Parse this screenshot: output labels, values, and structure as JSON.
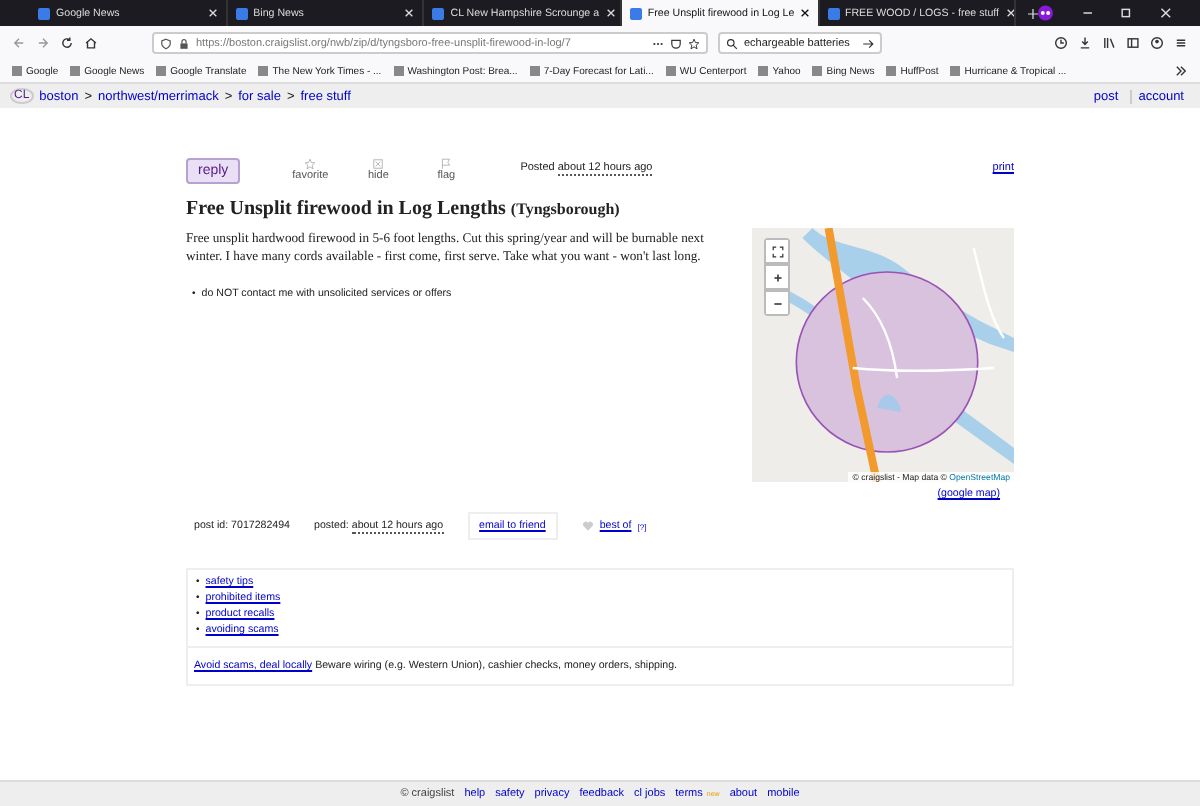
{
  "browser": {
    "tabs": [
      {
        "title": "Google News",
        "selected": false
      },
      {
        "title": "Bing News",
        "selected": false
      },
      {
        "title": "CL New Hampshire Scrounge a",
        "selected": false
      },
      {
        "title": "Free Unsplit firewood in Log Le",
        "selected": true
      },
      {
        "title": "FREE WOOD / LOGS - free stuff",
        "selected": false
      }
    ],
    "url": "https://boston.craigslist.org/nwb/zip/d/tyngsboro-free-unsplit-firewood-in-log/7",
    "search": "echargeable batteries",
    "bookmarks": [
      "Google",
      "Google News",
      "Google Translate",
      "The New York Times - ...",
      "Washington Post: Brea...",
      "7-Day Forecast for Lati...",
      "WU Centerport",
      "Yahoo",
      "Bing News",
      "HuffPost",
      "Hurricane & Tropical ..."
    ]
  },
  "header": {
    "logo": "CL",
    "breadcrumbs": [
      "boston",
      "northwest/merrimack",
      "for sale",
      "free stuff"
    ],
    "separator": ">",
    "links": [
      "post",
      "account"
    ]
  },
  "actions": {
    "reply": "reply",
    "tools": [
      {
        "label": "favorite",
        "kind": "star"
      },
      {
        "label": "hide",
        "kind": "hide"
      },
      {
        "label": "flag",
        "kind": "flag"
      }
    ],
    "posted_label": "Posted",
    "posted_time": "about 12 hours ago",
    "print": "print"
  },
  "title": "Free Unsplit firewood in Log Lengths",
  "location": "(Tyngsborough)",
  "body": "Free unsplit hardwood firewood in 5-6 foot lengths. Cut this spring/year and will be burnable next winter. I have many cords available - first come, first serve. Take what you want - won't last long.",
  "bullet": "•",
  "notices": [
    "do NOT contact me with unsolicited services or offers"
  ],
  "map": {
    "attribution_prefix": "© craigslist - Map data ©",
    "attribution_link": "OpenStreetMap",
    "google_link": "(google map)"
  },
  "postinfo": {
    "post_id": "post id: 7017282494",
    "posted_label": "posted:",
    "posted_time": "about 12 hours ago",
    "email": "email to friend",
    "best_of": "best of",
    "best_of_mark": "[?]"
  },
  "safety": {
    "links": [
      "safety tips",
      "prohibited items",
      "product recalls",
      "avoiding scams"
    ],
    "warning_link": "Avoid scams, deal locally",
    "warning_text": "Beware wiring (e.g. Western Union), cashier checks, money orders, shipping."
  },
  "footer": {
    "copyright": "© craigslist",
    "links": [
      "help",
      "safety",
      "privacy",
      "feedback",
      "cl jobs",
      "terms",
      "about",
      "mobile"
    ],
    "new_badge": "new"
  }
}
